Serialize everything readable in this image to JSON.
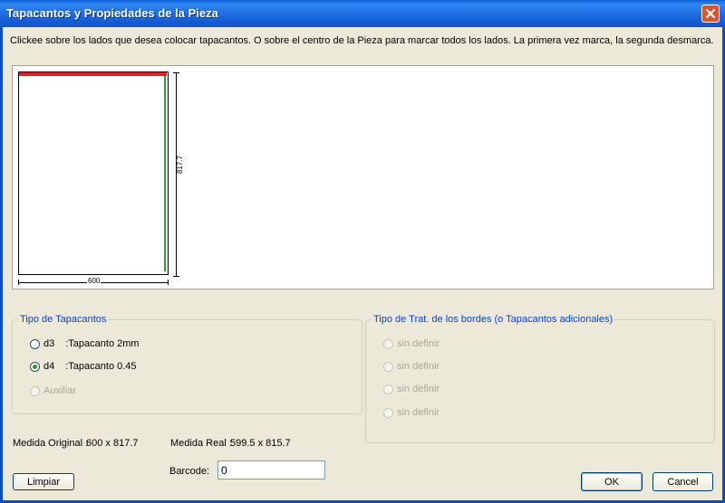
{
  "window": {
    "title": "Tapacantos y Propiedades de la Pieza"
  },
  "instructions": "Clickee sobre los lados que desea colocar tapacantos. O sobre el centro de la Pieza para marcar todos los lados. La primera vez marca, la segunda desmarca.",
  "piece": {
    "width_label": "600",
    "height_label": "817.7",
    "edge_top_color": "#e02020",
    "edge_right_color": "#3a9a3a"
  },
  "tapacantos_group": {
    "legend": "Tipo de Tapacantos",
    "options": [
      {
        "code": "d3",
        "desc": ":Tapacanto 2mm",
        "checked": false,
        "disabled": false
      },
      {
        "code": "d4",
        "desc": ":Tapacanto 0.45",
        "checked": true,
        "disabled": false
      },
      {
        "code": "Auxiliar",
        "desc": "",
        "checked": false,
        "disabled": true
      }
    ]
  },
  "tratamiento_group": {
    "legend": "Tipo de Trat. de los bordes (o Tapacantos adicionales)",
    "options": [
      "sin definir",
      "sin definir",
      "sin definir",
      "sin definir"
    ]
  },
  "medida_original": {
    "label": "Medida Original :",
    "value": "600 x 817.7"
  },
  "medida_real": {
    "label": "Medida Real :",
    "value": "599.5 x 815.7"
  },
  "barcode": {
    "label": "Barcode:",
    "value": "0"
  },
  "buttons": {
    "limpiar": "Limpiar",
    "ok": "OK",
    "cancel": "Cancel"
  }
}
